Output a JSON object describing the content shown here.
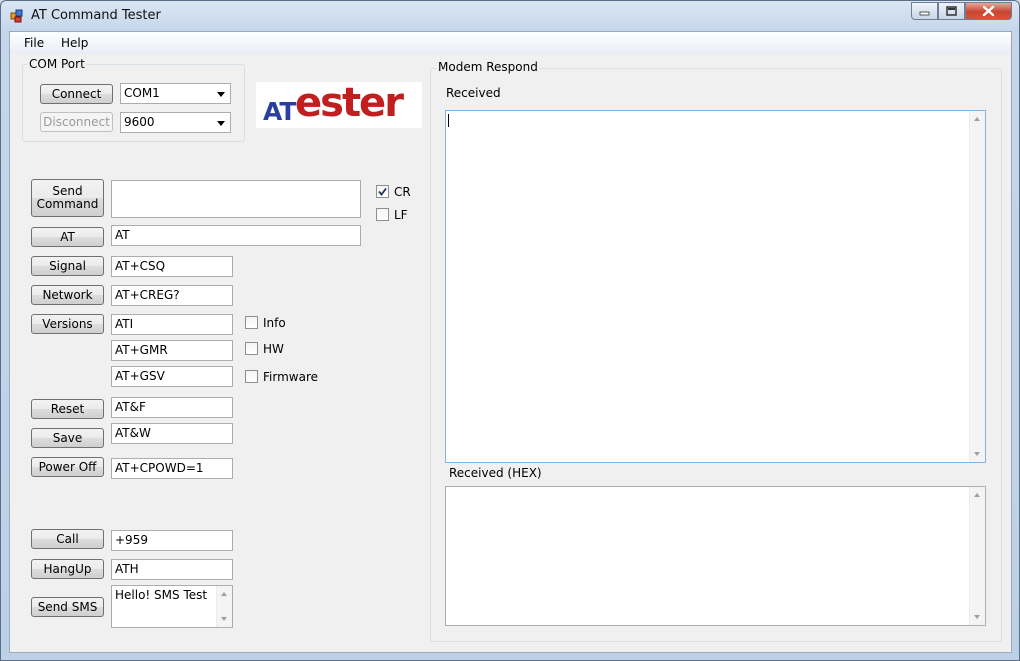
{
  "window": {
    "title": "AT Command Tester"
  },
  "menu": {
    "items": [
      "File",
      "Help"
    ]
  },
  "com_port": {
    "title": "COM Port",
    "connect_label": "Connect",
    "disconnect_label": "Disconnect",
    "port_value": "COM1",
    "baud_value": "9600"
  },
  "logo": {
    "at": "AT",
    "tester": "ester"
  },
  "commands": {
    "send_command_label": "Send\nCommand",
    "send_command_value": "",
    "cr_label": "CR",
    "cr_checked": true,
    "lf_label": "LF",
    "lf_checked": false,
    "at_label": "AT",
    "at_value": "AT",
    "signal_label": "Signal",
    "signal_value": "AT+CSQ",
    "network_label": "Network",
    "network_value": "AT+CREG?",
    "versions_label": "Versions",
    "ati_value": "ATI",
    "info_label": "Info",
    "gmr_value": "AT+GMR",
    "hw_label": "HW",
    "gsv_value": "AT+GSV",
    "firmware_label": "Firmware",
    "reset_label": "Reset",
    "reset_value": "AT&F",
    "save_label": "Save",
    "save_value": "AT&W",
    "poweroff_label": "Power Off",
    "poweroff_value": "AT+CPOWD=1",
    "call_label": "Call",
    "call_value": "+959",
    "hangup_label": "HangUp",
    "hangup_value": "ATH",
    "sendsms_label": "Send SMS",
    "sms_value": "Hello! SMS Test"
  },
  "modem": {
    "title": "Modem Respond",
    "received_label": "Received",
    "received_hex_label": "Received (HEX)"
  }
}
